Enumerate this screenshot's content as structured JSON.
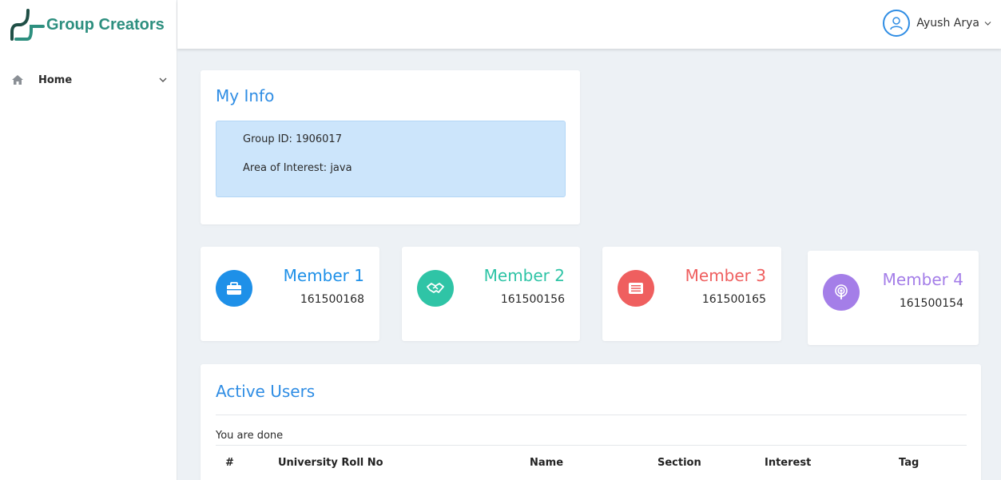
{
  "brand": {
    "name": "Group Creators",
    "color": "#2d8f7f"
  },
  "sidebar": {
    "items": [
      {
        "label": "Home",
        "icon": "home-icon"
      }
    ]
  },
  "topbar": {
    "user_name": "Ayush Arya",
    "user_icon": "user-icon"
  },
  "my_info": {
    "title": "My Info",
    "group_id": "Group ID: 1906017",
    "area_of_interest": "Area of Interest: java"
  },
  "members": [
    {
      "title": "Member 1",
      "roll": "161500168",
      "color": "#1e90e8",
      "icon": "briefcase-icon"
    },
    {
      "title": "Member 2",
      "roll": "161500156",
      "color": "#2fc4a6",
      "icon": "handshake-icon"
    },
    {
      "title": "Member 3",
      "roll": "161500165",
      "color": "#ef5f5f",
      "icon": "list-icon"
    },
    {
      "title": "Member 4",
      "roll": "161500154",
      "color": "#a47ee8",
      "icon": "podcast-icon"
    }
  ],
  "active_users": {
    "title": "Active Users",
    "note": "You are done",
    "columns": [
      "#",
      "University Roll No",
      "Name",
      "Section",
      "Interest",
      "Tag"
    ]
  }
}
